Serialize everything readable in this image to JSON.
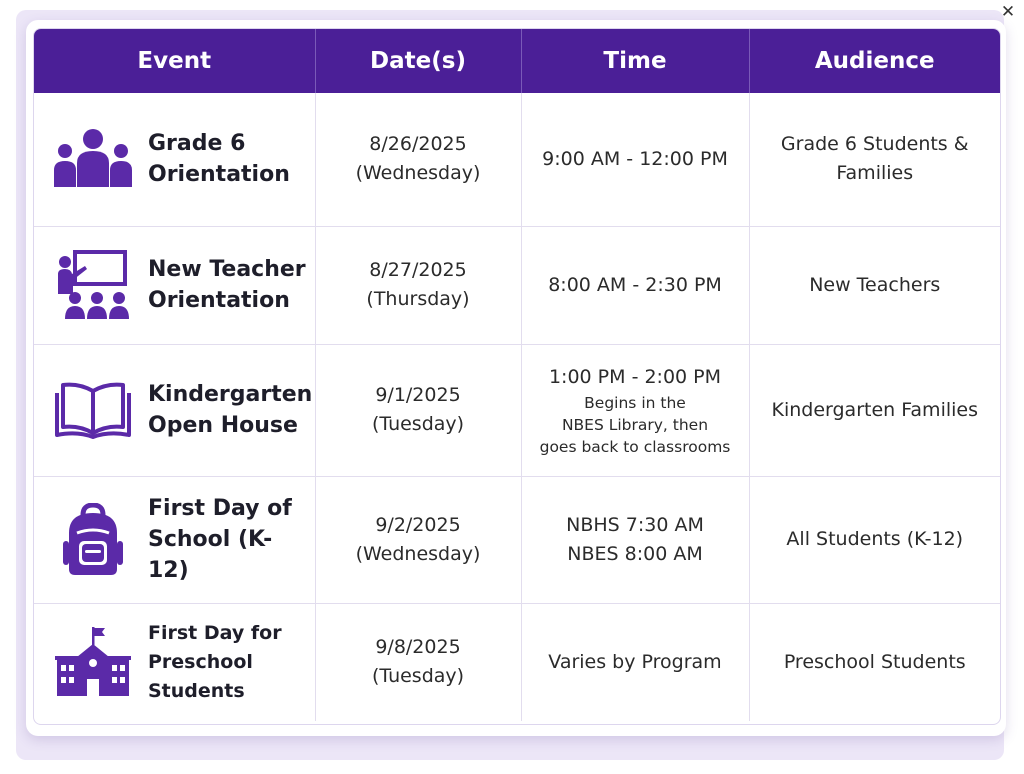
{
  "window": {
    "close_label": "✕"
  },
  "colors": {
    "header_bg": "#4b1f97",
    "icon_purple": "#5b2aa8",
    "backdrop": "#ece6f7"
  },
  "table": {
    "headers": [
      "Event",
      "Date(s)",
      "Time",
      "Audience"
    ],
    "rows": [
      {
        "icon": "group-people-icon",
        "event": [
          "Grade 6",
          "Orientation"
        ],
        "date": [
          "8/26/2025",
          "(Wednesday)"
        ],
        "time": [
          "9:00 AM - 12:00 PM"
        ],
        "time_note": [],
        "audience": [
          "Grade 6 Students &",
          "Families"
        ]
      },
      {
        "icon": "teacher-classroom-icon",
        "event": [
          "New Teacher",
          "Orientation"
        ],
        "date": [
          "8/27/2025",
          "(Thursday)"
        ],
        "time": [
          "8:00 AM - 2:30 PM"
        ],
        "time_note": [],
        "audience": [
          "New Teachers"
        ]
      },
      {
        "icon": "open-book-icon",
        "event": [
          "Kindergarten",
          "Open House"
        ],
        "date": [
          "9/1/2025",
          "(Tuesday)"
        ],
        "time": [
          "1:00 PM - 2:00 PM"
        ],
        "time_note": [
          "Begins in the",
          "NBES Library, then",
          "goes back to classrooms"
        ],
        "audience": [
          "Kindergarten Families"
        ]
      },
      {
        "icon": "backpack-icon",
        "event": [
          "First Day of",
          "School (K-12)"
        ],
        "date": [
          "9/2/2025",
          "(Wednesday)"
        ],
        "time": [
          "NBHS 7:30 AM",
          "NBES 8:00 AM"
        ],
        "time_note": [],
        "audience": [
          "All Students (K-12)"
        ]
      },
      {
        "icon": "school-building-icon",
        "event": [
          "First Day for",
          "Preschool Students"
        ],
        "date": [
          "9/8/2025",
          "(Tuesday)"
        ],
        "time": [
          "Varies by Program"
        ],
        "time_note": [],
        "audience": [
          "Preschool Students"
        ]
      }
    ]
  }
}
